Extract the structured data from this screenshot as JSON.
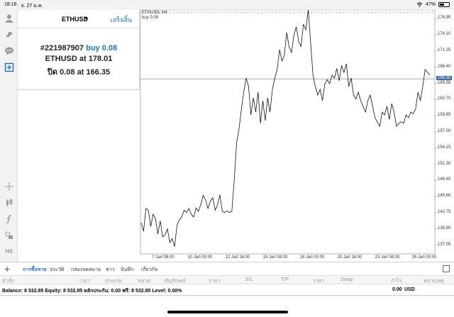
{
  "status": {
    "time": "18:16",
    "date": "จ. 27 ม.ค.",
    "battery": "47%",
    "battery_level": 0.47
  },
  "panel": {
    "symbol": "ETHUSD",
    "caret": "▼",
    "done": "เสร็จสิ้น",
    "order_id": "#221987907",
    "order_action": "buy 0.08",
    "open_symbol": "ETHUSD at",
    "open_price": "178.01",
    "close_label": "ปิด 0.08 at",
    "close_price": "166.35"
  },
  "chart_data": {
    "type": "line",
    "title": "ETHUSD, H4",
    "subtitle": "buy 0.08",
    "ylim": [
      135.5,
      178.5
    ],
    "y_ticks": [
      "176.95",
      "174.10",
      "171.25",
      "168.40",
      "165.55",
      "162.70",
      "159.85",
      "157.00",
      "154.15",
      "151.30",
      "148.45",
      "145.60",
      "142.75",
      "139.90",
      "137.05"
    ],
    "x_ticks": [
      "7 Jan 08:00",
      "10 Jan 00:00",
      "12 Jan 16:00",
      "15 Jan 08:00",
      "18 Jan 00:00",
      "20 Jan 16:00",
      "23 Jan 08:00",
      "26 Jan 00:00"
    ],
    "current_price": "166.35",
    "entry_price": 178.01,
    "close_price": 166.35,
    "values": [
      141.0,
      139.5,
      143.5,
      143.2,
      140.3,
      142.5,
      141.7,
      139.0,
      141.3,
      138.5,
      138.8,
      139.9,
      137.5,
      138.2,
      136.8,
      140.5,
      141.5,
      142.0,
      143.2,
      142.8,
      143.5,
      142.5,
      142.0,
      143.6,
      143.0,
      144.2,
      145.8,
      145.0,
      143.5,
      144.8,
      145.4,
      143.2,
      144.1,
      145.9,
      143.0,
      142.8,
      143.1,
      142.8,
      143.0,
      148.5,
      155.0,
      157.5,
      161.0,
      164.0,
      166.5,
      165.0,
      160.0,
      163.0,
      160.5,
      164.0,
      158.5,
      162.5,
      159.0,
      163.0,
      160.5,
      164.5,
      166.5,
      168.0,
      171.5,
      169.5,
      170.5,
      174.5,
      172.0,
      171.0,
      174.0,
      175.5,
      173.0,
      172.0,
      176.0,
      175.0,
      178.5,
      173.0,
      167.0,
      165.0,
      163.5,
      164.5,
      162.5,
      165.5,
      166.2,
      165.5,
      167.0,
      166.5,
      168.2,
      166.0,
      168.7,
      167.5,
      169.0,
      165.0,
      166.5,
      163.5,
      162.8,
      164.0,
      162.5,
      161.5,
      160.5,
      162.5,
      163.5,
      161.5,
      159.5,
      158.7,
      158.0,
      160.5,
      160.0,
      161.5,
      159.2,
      162.0,
      160.5,
      158.0,
      158.5,
      158.8,
      158.5,
      160.0,
      159.5,
      160.5,
      160.2,
      161.0,
      164.0,
      162.5,
      165.0,
      168.0,
      167.5,
      167.0
    ]
  },
  "tabs": [
    "การซื้อขาย",
    "ประวัติ",
    "กล่องจดหมาย",
    "ข่าว",
    "บันทึก",
    "เกี่ยวกับ"
  ],
  "columns": [
    "คำสั่ง",
    "เวลา",
    "ประเภท",
    "ขนาด",
    "สัญลักษณ์",
    "ราคา",
    "S/L",
    "T/P",
    "ราคา",
    "Swap",
    "กำไร",
    "หมายเหตุ"
  ],
  "balance": {
    "text": "Balance: 8 532.85 Equity: 8 532.85 หลักประกัน: 0.00 ฟรี: 8 532.85 Level: 0.00%",
    "profit": "0.00",
    "currency": "USD"
  }
}
